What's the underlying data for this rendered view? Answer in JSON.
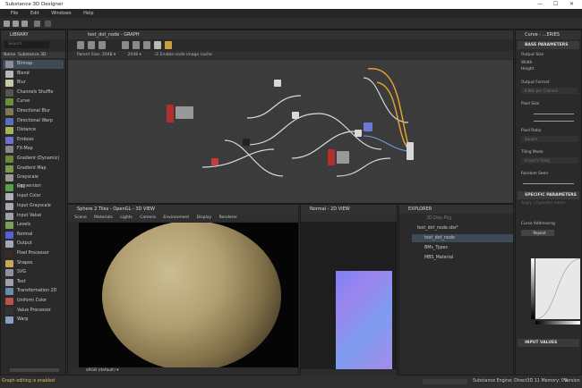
{
  "window": {
    "title": "Substance 3D Designer",
    "controls": [
      "—",
      "☐",
      "✕"
    ]
  },
  "menu": [
    "File",
    "Edit",
    "Windows",
    "Help"
  ],
  "library": {
    "title": "LIBRARY",
    "search_placeholder": "Search",
    "column_name": "Name",
    "column_filter": "Substance 3D",
    "items": [
      {
        "label": "Bitmap",
        "color": "#8a9099"
      },
      {
        "label": "Blend",
        "color": "#b8b8b8"
      },
      {
        "label": "Blur",
        "color": "#c9c7a6"
      },
      {
        "label": "Channels Shuffle",
        "color": "#555"
      },
      {
        "label": "Curve",
        "color": "#6c8f3a"
      },
      {
        "label": "Directional Blur",
        "color": "#7d7a55"
      },
      {
        "label": "Directional Warp",
        "color": "#5a6fbf"
      },
      {
        "label": "Distance",
        "color": "#a4b45a"
      },
      {
        "label": "Emboss",
        "color": "#7070c8"
      },
      {
        "label": "FX-Map",
        "color": "#888"
      },
      {
        "label": "Gradient (Dynamic)",
        "color": "#6a8a3a"
      },
      {
        "label": "Gradient Map",
        "color": "#7a9a4a"
      },
      {
        "label": "Grayscale Conversion",
        "color": "#999"
      },
      {
        "label": "HSL",
        "color": "#5aa04a"
      },
      {
        "label": "Input Color",
        "color": "#b0b0b8"
      },
      {
        "label": "Input Grayscale",
        "color": "#a8a8b0"
      },
      {
        "label": "Input Value",
        "color": "#a0a0a8"
      },
      {
        "label": "Levels",
        "color": "#7aa05a"
      },
      {
        "label": "Normal",
        "color": "#5560d8"
      },
      {
        "label": "Output",
        "color": "#a0a8b8"
      },
      {
        "label": "Pixel Processor",
        "color": "#3a2a2a"
      },
      {
        "label": "Shapes",
        "color": "#c8a858"
      },
      {
        "label": "SVG",
        "color": "#9090a0"
      },
      {
        "label": "Text",
        "color": "#a0a0a8"
      },
      {
        "label": "Transformation 2D",
        "color": "#6a8ab0"
      },
      {
        "label": "Uniform Color",
        "color": "#c05050"
      },
      {
        "label": "Value Processor",
        "color": "#333"
      },
      {
        "label": "Warp",
        "color": "#8aa0c0"
      }
    ]
  },
  "graph": {
    "title": "test_dot_node - GRAPH",
    "parent_size_label": "Parent Size:",
    "size_x": "2048",
    "size_y": "2048",
    "cache_label": "Enable node image cache"
  },
  "view3d": {
    "title": "Sphere 2 Tiles - OpenGL - 3D VIEW",
    "menu": [
      "Scene",
      "Materials",
      "Lights",
      "Camera",
      "Environment",
      "Display",
      "Renderer"
    ],
    "colorspace": "sRGB (default)"
  },
  "view2d": {
    "title": "Normal - 2D VIEW"
  },
  "explorer": {
    "title": "EXPLORER",
    "root": "3D.Dep.Pkg",
    "package": "test_dot_node.sbs*",
    "items": [
      "test_dot_node",
      "BMs_Types",
      "MBS_Material"
    ]
  },
  "properties": {
    "title": "Curve - ...ERIES",
    "basic_section": "BASE PARAMETERS",
    "output_size": "Output Size",
    "width": "Width",
    "height": "Height",
    "output_format": "Output Format",
    "output_format_value": "8 Bits per Channel",
    "pixel_size": "Pixel Size",
    "pixel_ratio": "Pixel Ratio",
    "pixel_ratio_value": "Square",
    "tiling_mode": "Tiling Mode",
    "tiling_value": "H and V Tiling",
    "random_seed": "Random Seed",
    "specific_section": "SPECIFIC PARAMETERS",
    "apply_to": "Apply | Operator name",
    "curve_addressing": "Curve Addressing",
    "repeat": "Repeat",
    "input_values": "INPUT VALUES"
  },
  "status": {
    "left": "Graph editing is enabled",
    "engine": "Substance Engine: Direct3D 11  Memory: 0%",
    "version": "Version"
  }
}
